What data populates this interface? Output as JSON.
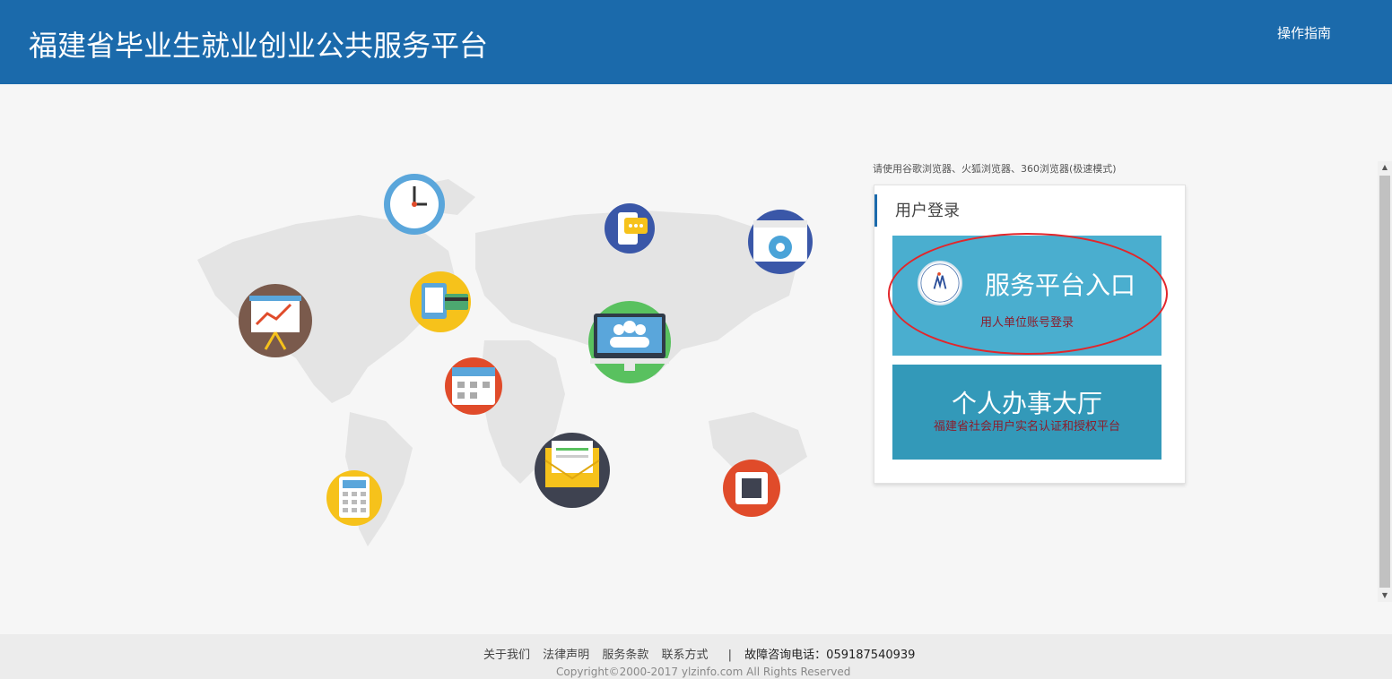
{
  "header": {
    "title": "福建省毕业生就业创业公共服务平台",
    "guide_link": "操作指南"
  },
  "browser_tip": "请使用谷歌浏览器、火狐浏览器、360浏览器(极速模式)",
  "login": {
    "title": "用户登录",
    "entry_label": "服务平台入口",
    "entry_sub": "用人单位账号登录",
    "hall_label": "个人办事大厅",
    "hall_sub": "福建省社会用户实名认证和授权平台"
  },
  "footer": {
    "about": "关于我们",
    "legal": "法律声明",
    "terms": "服务条款",
    "contact": "联系方式",
    "phone_label": "故障咨询电话：",
    "phone": "059187540939",
    "copyright": "Copyright©2000-2017 ylzinfo.com All Rights Reserved"
  },
  "colors": {
    "header_bg": "#1b6aab",
    "entry_bg": "#4aaecf",
    "hall_bg": "#3399b9",
    "highlight_circle": "#e2262b"
  },
  "icons": [
    "clock-icon",
    "chat-phone-icon",
    "settings-window-icon",
    "chart-board-icon",
    "tablet-card-icon",
    "team-monitor-icon",
    "calendar-icon",
    "mail-icon",
    "calculator-icon",
    "chip-icon"
  ]
}
